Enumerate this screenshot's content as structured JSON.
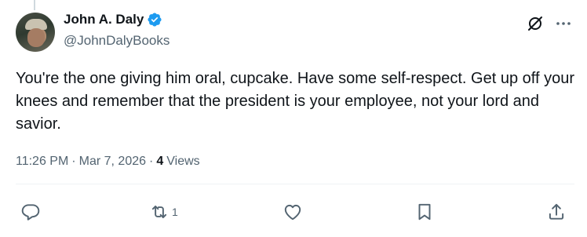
{
  "author": {
    "display_name": "John A. Daly",
    "handle": "@JohnDalyBooks",
    "verified": true,
    "verified_color": "#1d9bf0"
  },
  "tweet": {
    "text": "You're the one giving him oral, cupcake. Have some self-respect. Get up off your knees and remember that the president is your employee, not your lord and savior."
  },
  "meta": {
    "time": "11:26 PM",
    "sep1": "·",
    "date": "Mar 7, 2026",
    "sep2": "·",
    "views_count": "4",
    "views_label": "Views"
  },
  "actions": {
    "reply_icon": "reply-icon",
    "repost_icon": "repost-icon",
    "repost_count": "1",
    "like_icon": "heart-icon",
    "bookmark_icon": "bookmark-icon",
    "share_icon": "share-icon"
  },
  "colors": {
    "text": "#0f1419",
    "secondary": "#536471",
    "divider": "#eff3f4"
  }
}
